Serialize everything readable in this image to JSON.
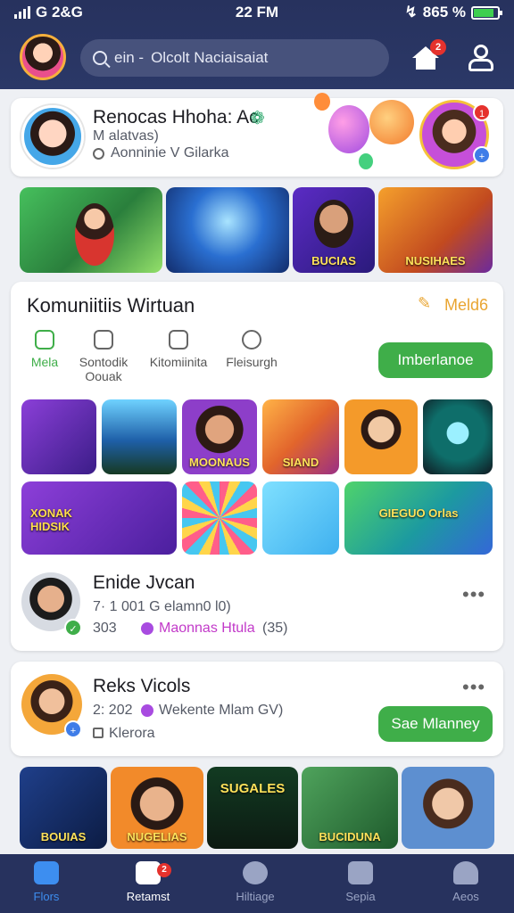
{
  "status": {
    "carrier": "G 2&G",
    "time": "22 FM",
    "battery": "865 %",
    "battery_level": 0.75
  },
  "header": {
    "search_prefix": "ein -",
    "search_text": "Olcolt Naciaisaiat",
    "notif_count": "2"
  },
  "profile_card": {
    "title": "Renocas Hhoha: Ac",
    "subtitle": "M alatvas)",
    "location": "Aonninie V Gilarka",
    "badge_count": "1"
  },
  "featured_tiles": [
    {
      "caption": ""
    },
    {
      "caption": ""
    },
    {
      "caption": "BUCIAS"
    },
    {
      "caption": "NUSIHAES"
    }
  ],
  "community": {
    "title": "Komuniitiis Wirtuan",
    "more_label": "Meld6",
    "categories": [
      {
        "label": "Mela",
        "icon": "home-icon"
      },
      {
        "label": "Sontodik Oouak",
        "icon": "chat-icon"
      },
      {
        "label": "Kitomiinita",
        "icon": "card-icon"
      },
      {
        "label": "Fleisurgh",
        "icon": "gear-icon"
      }
    ],
    "action_label": "Imberlanoe"
  },
  "grid_row1": [
    {
      "caption": ""
    },
    {
      "caption": ""
    },
    {
      "caption": "MOONAUS"
    },
    {
      "caption": "SIAND"
    },
    {
      "caption": ""
    },
    {
      "caption": ""
    }
  ],
  "grid_row2": [
    {
      "caption": "XONAK HIDSIK"
    },
    {
      "caption": ""
    },
    {
      "caption": ""
    },
    {
      "caption": "GIEGUO Orlas"
    }
  ],
  "post1": {
    "name": "Enide Jvcan",
    "line1": "7· 1 001 G elamn0 l0)",
    "count": "303",
    "tag": "Maonnas Htula",
    "tag_suffix": "(35)"
  },
  "post2": {
    "name": "Reks Vicols",
    "line1": "2: 202",
    "line1_rest": "Wekente Mlam GV)",
    "line2": "Klerora",
    "action_label": "Sae Mlanney"
  },
  "bottom_tiles": [
    {
      "caption": "BOUIAS"
    },
    {
      "caption": "NUGELIAS"
    },
    {
      "caption": "SUGALES"
    },
    {
      "caption": "BUCIDUNA"
    },
    {
      "caption": ""
    }
  ],
  "bottom_nav": [
    {
      "label": "Flors",
      "active": true
    },
    {
      "label": "Retamst",
      "active": false
    },
    {
      "label": "Hiltiage",
      "active": false
    },
    {
      "label": "Sepia",
      "active": false
    },
    {
      "label": "Aeos",
      "active": false
    }
  ],
  "colors": {
    "header": "#27325e",
    "accent_green": "#3fae49",
    "accent_blue": "#3d8ef0",
    "badge_red": "#e5322d"
  }
}
